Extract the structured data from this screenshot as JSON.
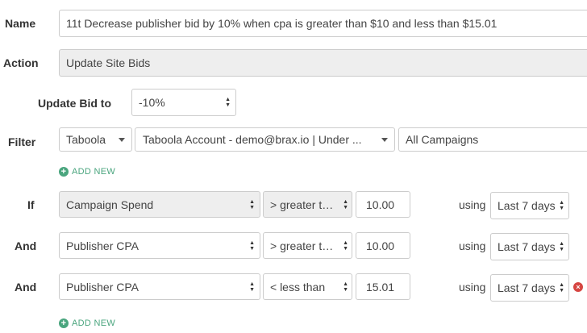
{
  "name": {
    "label": "Name",
    "value": "11t Decrease publisher bid by 10% when cpa is greater than $10 and less than $15.01"
  },
  "action": {
    "label": "Action",
    "value": "Update Site Bids"
  },
  "update_bid": {
    "label": "Update Bid to",
    "value": "-10%"
  },
  "filter": {
    "label": "Filter",
    "network": "Taboola",
    "account": "Taboola Account - demo@brax.io | Under ...",
    "campaigns": "All Campaigns"
  },
  "add_new_label": "ADD NEW",
  "conditions": [
    {
      "connector": "If",
      "metric": "Campaign Spend",
      "operator": "> greater than",
      "value": "10.00",
      "using": "using",
      "period": "Last 7 days"
    },
    {
      "connector": "And",
      "metric": "Publisher CPA",
      "operator": "> greater than",
      "value": "10.00",
      "using": "using",
      "period": "Last 7 days"
    },
    {
      "connector": "And",
      "metric": "Publisher CPA",
      "operator": "< less than",
      "value": "15.01",
      "using": "using",
      "period": "Last 7 days"
    }
  ],
  "colors": {
    "accent_green": "#4aa57e",
    "remove_red": "#d64541",
    "disabled_gray": "#eeeeee"
  },
  "icons": {
    "add": "plus-circle-icon",
    "remove": "remove-circle-icon",
    "select": "up-down-arrows-icon",
    "dropdown": "caret-down-icon"
  }
}
